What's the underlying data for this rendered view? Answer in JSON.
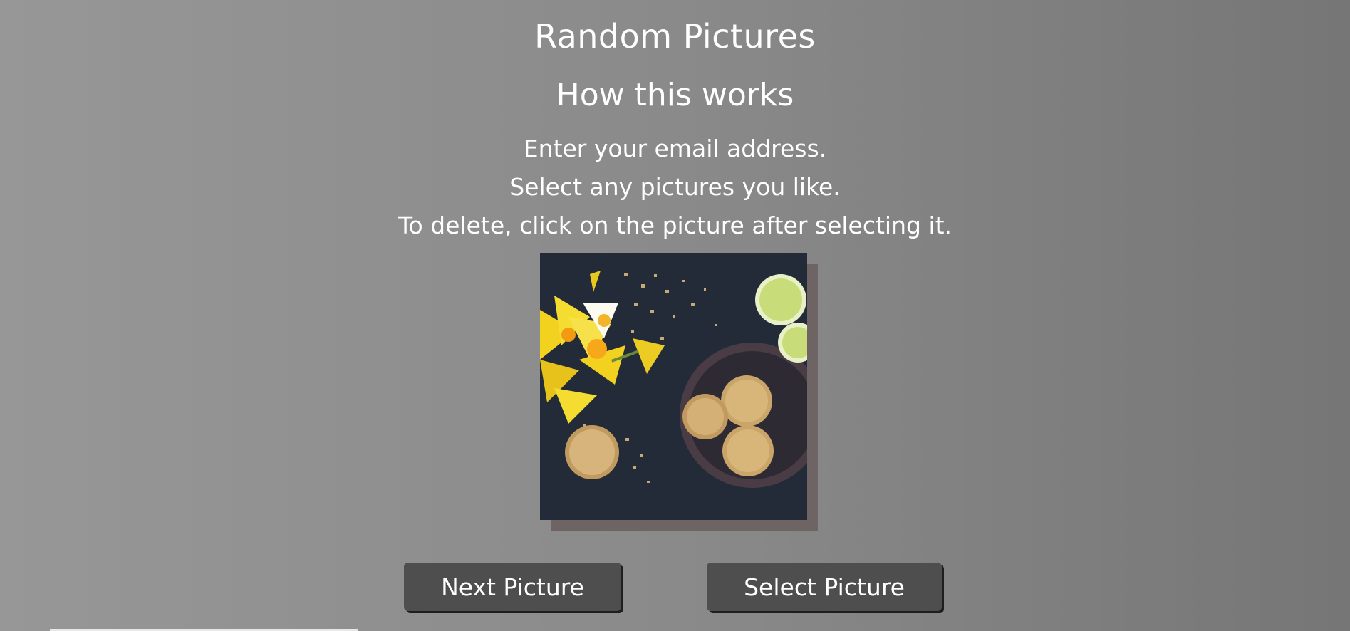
{
  "header": {
    "title": "Random Pictures",
    "subtitle": "How this works"
  },
  "instructions": [
    "Enter your email address.",
    "Select any pictures you like.",
    "To delete, click on the picture after selecting it."
  ],
  "picture": {
    "icon": "food-photo-cookies-daffodils-lemon"
  },
  "buttons": {
    "next_label": "Next Picture",
    "select_label": "Select Picture"
  },
  "colors": {
    "button_bg": "#4e4e4e",
    "picture_shadow": "#6e6464",
    "text": "#ffffff"
  }
}
